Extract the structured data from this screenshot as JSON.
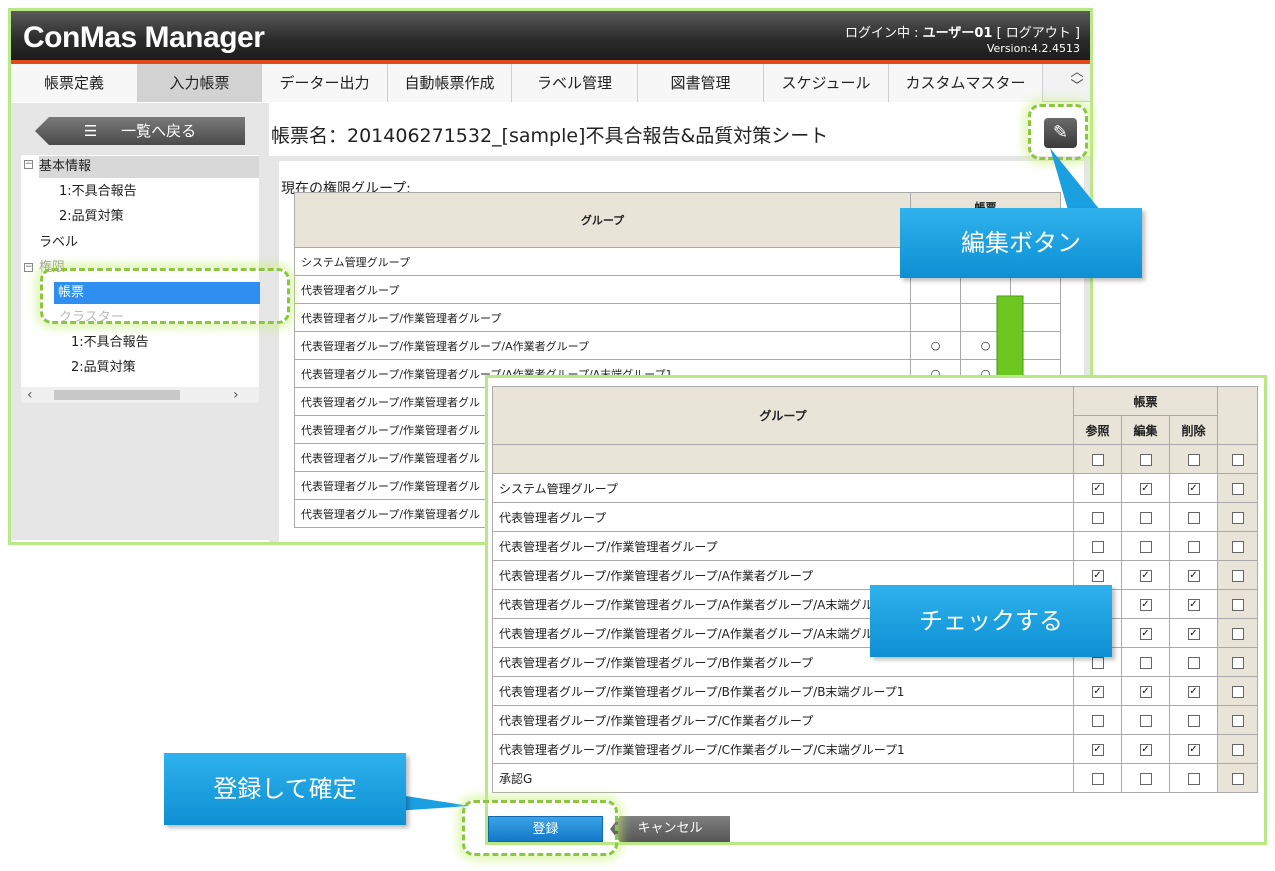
{
  "app": {
    "title": "ConMas Manager",
    "login_prefix": "ログイン中 : ",
    "user": "ユーザー01",
    "logout_link": "[ ログアウト ]",
    "version": "Version:4.2.4513"
  },
  "nav": {
    "tabs": [
      {
        "label": "帳票定義"
      },
      {
        "label": "入力帳票"
      },
      {
        "label": "データー出力"
      },
      {
        "label": "自動帳票作成"
      },
      {
        "label": "ラベル管理"
      },
      {
        "label": "図書管理"
      },
      {
        "label": "スケジュール"
      },
      {
        "label": "カスタムマスター"
      }
    ],
    "active": "入力帳票"
  },
  "sidebar": {
    "back_label": "一覧へ戻る",
    "tree": {
      "basic": "基本情報",
      "basic_1": "1:不具合報告",
      "basic_2": "2:品質対策",
      "label": "ラベル",
      "perm": "権限",
      "perm_form": "帳票",
      "cluster": "クラスター",
      "cluster_1": "1:不具合報告",
      "cluster_2": "2:品質対策"
    }
  },
  "main": {
    "form_title": "帳票名：201406271532_[sample]不具合報告&品質対策シート",
    "perm_caption": "現在の権限グループ:",
    "col_group": "グループ",
    "col_form": "帳票",
    "rows": [
      {
        "group": "システム管理グループ",
        "c1": "",
        "c2": ""
      },
      {
        "group": "代表管理者グループ",
        "c1": "",
        "c2": ""
      },
      {
        "group": "代表管理者グループ/作業管理者グループ",
        "c1": "",
        "c2": ""
      },
      {
        "group": "代表管理者グループ/作業管理者グループ/A作業者グループ",
        "c1": "○",
        "c2": "○"
      },
      {
        "group": "代表管理者グループ/作業管理者グループ/A作業者グループ/A末端グループ1",
        "c1": "○",
        "c2": "○"
      },
      {
        "group": "代表管理者グループ/作業管理者グル",
        "c1": "",
        "c2": ""
      },
      {
        "group": "代表管理者グループ/作業管理者グル",
        "c1": "",
        "c2": ""
      },
      {
        "group": "代表管理者グループ/作業管理者グル",
        "c1": "",
        "c2": ""
      },
      {
        "group": "代表管理者グループ/作業管理者グル",
        "c1": "",
        "c2": ""
      },
      {
        "group": "代表管理者グループ/作業管理者グル",
        "c1": "",
        "c2": ""
      }
    ]
  },
  "edit_panel": {
    "col_group": "グループ",
    "col_form": "帳票",
    "col_view": "参照",
    "col_edit": "編集",
    "col_delete": "削除",
    "rows": [
      {
        "group": "システム管理グループ",
        "view": true,
        "edit": true,
        "delete": true,
        "extra": false
      },
      {
        "group": "代表管理者グループ",
        "view": false,
        "edit": false,
        "delete": false,
        "extra": false
      },
      {
        "group": "代表管理者グループ/作業管理者グループ",
        "view": false,
        "edit": false,
        "delete": false,
        "extra": false
      },
      {
        "group": "代表管理者グループ/作業管理者グループ/A作業者グループ",
        "view": true,
        "edit": true,
        "delete": true,
        "extra": false
      },
      {
        "group": "代表管理者グループ/作業管理者グループ/A作業者グループ/A末端グル",
        "view": true,
        "edit": true,
        "delete": true,
        "extra": false
      },
      {
        "group": "代表管理者グループ/作業管理者グループ/A作業者グループ/A末端グル",
        "view": true,
        "edit": true,
        "delete": true,
        "extra": false
      },
      {
        "group": "代表管理者グループ/作業管理者グループ/B作業者グループ",
        "view": false,
        "edit": false,
        "delete": false,
        "extra": false
      },
      {
        "group": "代表管理者グループ/作業管理者グループ/B作業者グループ/B末端グループ1",
        "view": true,
        "edit": true,
        "delete": true,
        "extra": false
      },
      {
        "group": "代表管理者グループ/作業管理者グループ/C作業者グループ",
        "view": false,
        "edit": false,
        "delete": false,
        "extra": false
      },
      {
        "group": "代表管理者グループ/作業管理者グループ/C作業者グループ/C末端グループ1",
        "view": true,
        "edit": true,
        "delete": true,
        "extra": false
      },
      {
        "group": "承認G",
        "view": false,
        "edit": false,
        "delete": false,
        "extra": false
      }
    ],
    "register_label": "登録",
    "cancel_label": "キャンセル"
  },
  "callouts": {
    "edit": "編集ボタン",
    "check": "チェックする",
    "register": "登録して確定"
  },
  "colors": {
    "accent_green": "#8bc63e",
    "callout_blue": "#1a9fe0",
    "header_dark": "#2a2a2a",
    "header_stripe": "#e04a1c",
    "arrow_green": "#66c81c"
  },
  "icons": {
    "list": "list-icon",
    "edit": "edit-icon",
    "scroll_left": "chevron-left-icon",
    "scroll_right": "chevron-right-icon",
    "nav_scroll": "chevron-updown-icon"
  }
}
